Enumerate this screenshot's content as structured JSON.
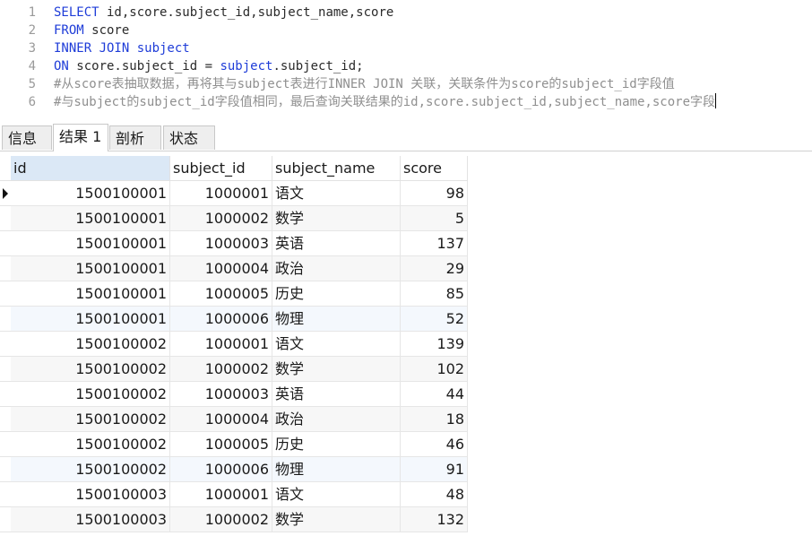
{
  "editor": {
    "lines": [
      {
        "no": "1",
        "segments": [
          {
            "t": "SELECT",
            "k": "kw"
          },
          {
            "t": " id,score.subject_id,subject_name,score",
            "k": "tx"
          }
        ]
      },
      {
        "no": "2",
        "segments": [
          {
            "t": "FROM",
            "k": "kw"
          },
          {
            "t": " score",
            "k": "tx"
          }
        ]
      },
      {
        "no": "3",
        "segments": [
          {
            "t": "INNER JOIN subject",
            "k": "kw"
          }
        ]
      },
      {
        "no": "4",
        "segments": [
          {
            "t": "ON",
            "k": "kw"
          },
          {
            "t": " score.subject_id = ",
            "k": "tx"
          },
          {
            "t": "subject",
            "k": "kw"
          },
          {
            "t": ".subject_id;",
            "k": "tx"
          }
        ]
      },
      {
        "no": "5",
        "segments": [
          {
            "t": "#从score表抽取数据，再将其与subject表进行INNER JOIN 关联，关联条件为score的subject_id字段值",
            "k": "cm"
          }
        ]
      },
      {
        "no": "6",
        "segments": [
          {
            "t": "#与subject的subject_id字段值相同，最后查询关联结果的id,score.subject_id,subject_name,score字段",
            "k": "cm"
          }
        ]
      }
    ]
  },
  "tabs": [
    {
      "label": "信息",
      "active": false
    },
    {
      "label": "结果 1",
      "active": true
    },
    {
      "label": "剖析",
      "active": false
    },
    {
      "label": "状态",
      "active": false
    }
  ],
  "grid": {
    "columns": [
      "id",
      "subject_id",
      "subject_name",
      "score"
    ],
    "rows": [
      [
        "1500100001",
        "1000001",
        "语文",
        "98"
      ],
      [
        "1500100001",
        "1000002",
        "数学",
        "5"
      ],
      [
        "1500100001",
        "1000003",
        "英语",
        "137"
      ],
      [
        "1500100001",
        "1000004",
        "政治",
        "29"
      ],
      [
        "1500100001",
        "1000005",
        "历史",
        "85"
      ],
      [
        "1500100001",
        "1000006",
        "物理",
        "52"
      ],
      [
        "1500100002",
        "1000001",
        "语文",
        "139"
      ],
      [
        "1500100002",
        "1000002",
        "数学",
        "102"
      ],
      [
        "1500100002",
        "1000003",
        "英语",
        "44"
      ],
      [
        "1500100002",
        "1000004",
        "政治",
        "18"
      ],
      [
        "1500100002",
        "1000005",
        "历史",
        "46"
      ],
      [
        "1500100002",
        "1000006",
        "物理",
        "91"
      ],
      [
        "1500100003",
        "1000001",
        "语文",
        "48"
      ],
      [
        "1500100003",
        "1000002",
        "数学",
        "132"
      ]
    ]
  }
}
